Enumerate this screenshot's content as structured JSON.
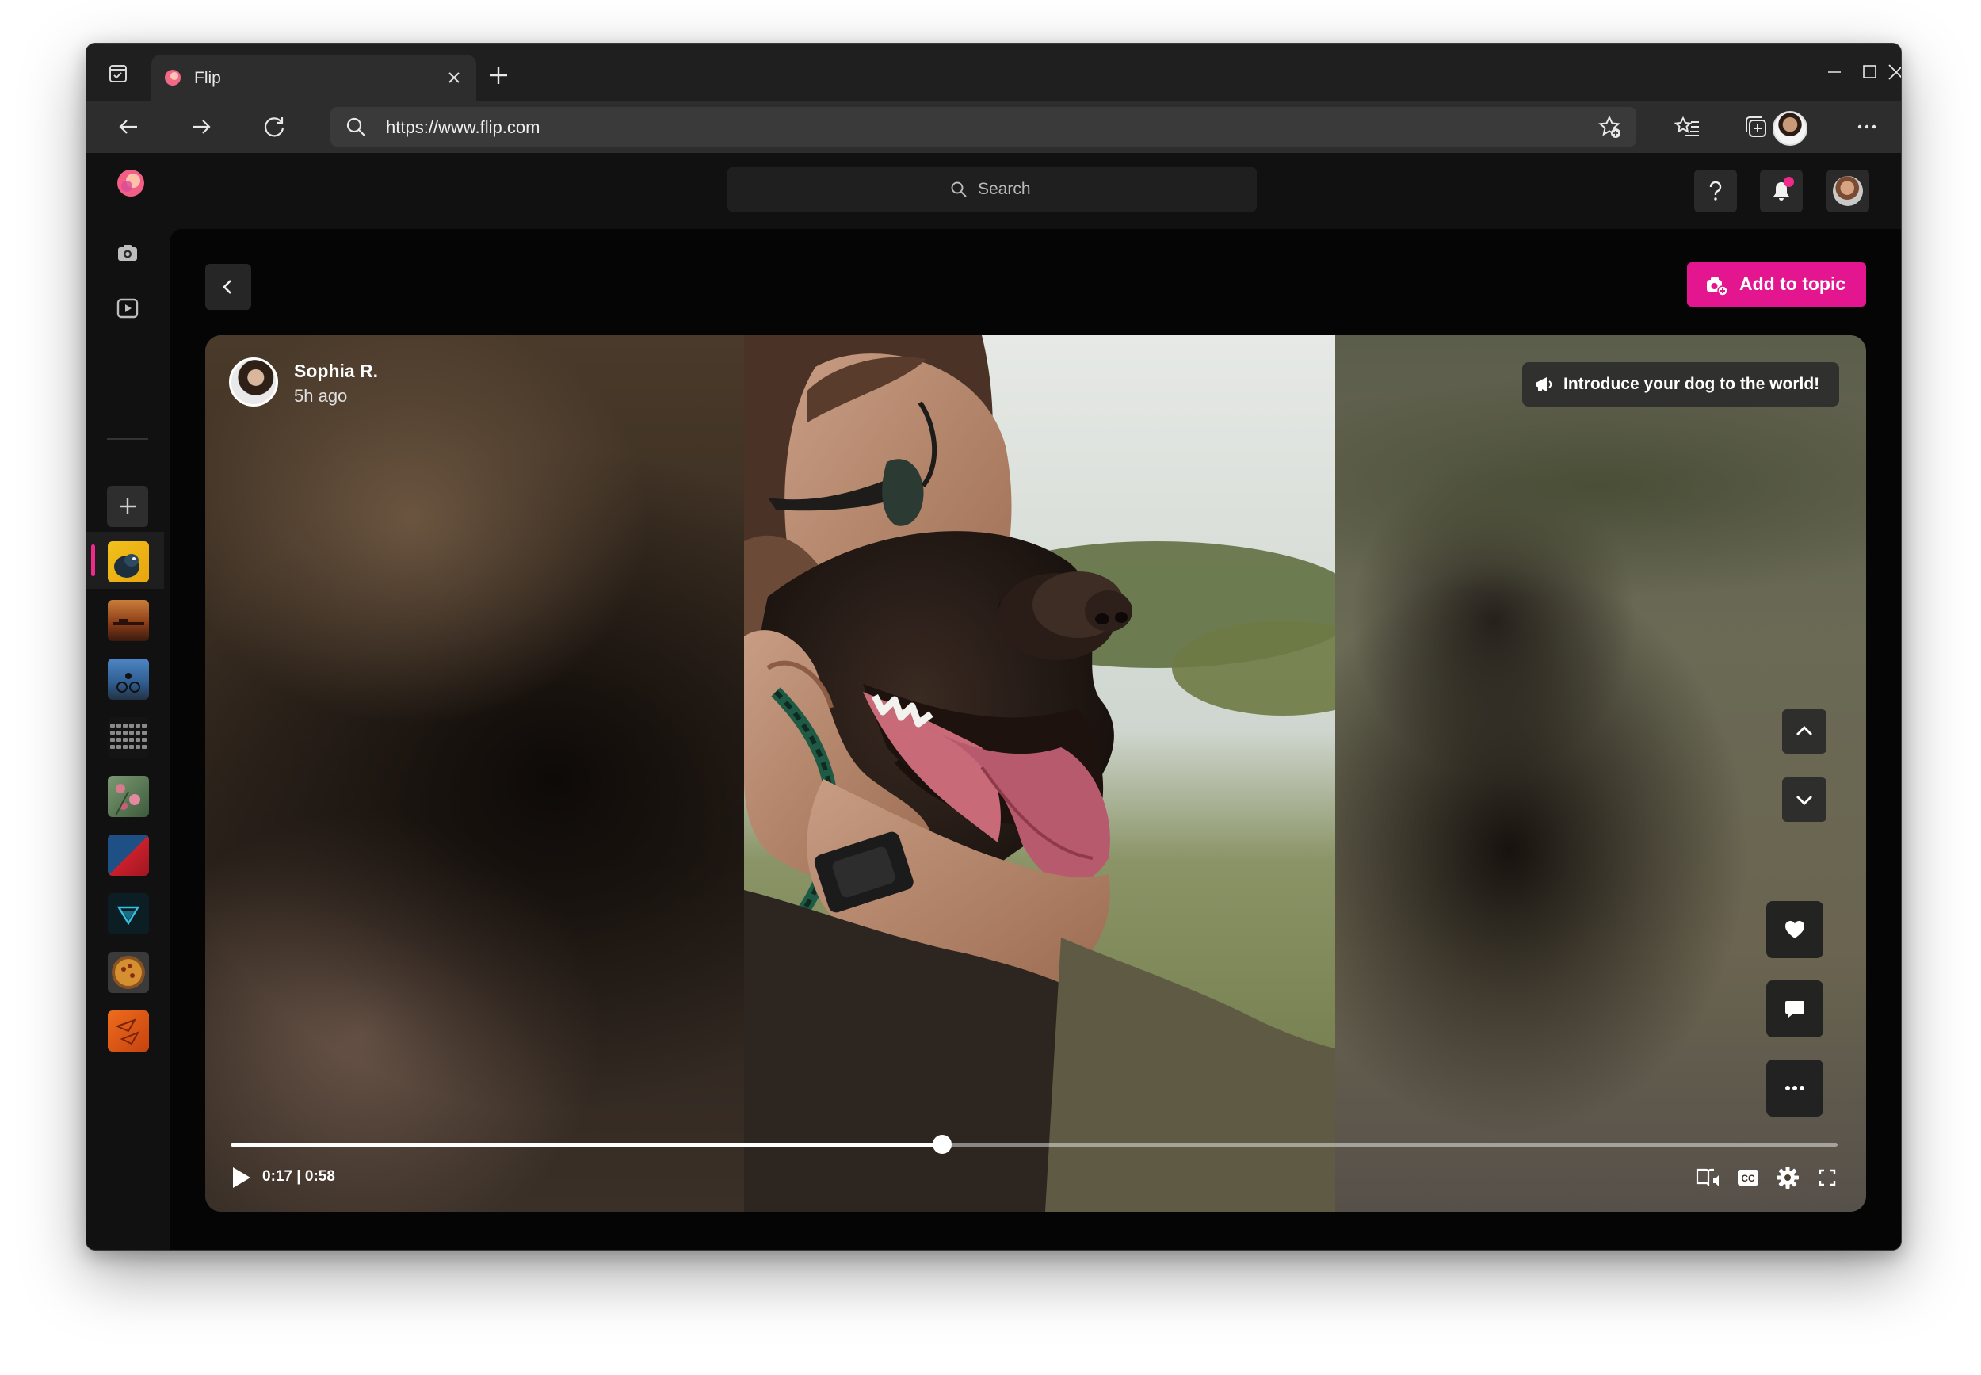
{
  "browser": {
    "tab_title": "Flip",
    "url": "https://www.flip.com"
  },
  "app": {
    "search_placeholder": "Search",
    "add_to_topic_label": "Add to topic",
    "accent": "#e3168f"
  },
  "post": {
    "author_name": "Sophia R.",
    "posted_ago": "5h ago",
    "prompt": "Introduce your dog to the world!",
    "time_current": "0:17",
    "time_total": "0:58",
    "time_display": "0:17 | 0:58",
    "progress": 0.443
  },
  "sidebar": {
    "topics": [
      {
        "name": "dog-topic",
        "colors": [
          "#e8b21a",
          "#1a3c4e"
        ]
      },
      {
        "name": "sunset-topic",
        "colors": [
          "#b0561e",
          "#3c1f12"
        ]
      },
      {
        "name": "cycling-topic",
        "colors": [
          "#3d6fa8",
          "#1f2b3a"
        ]
      },
      {
        "name": "keyboard-topic",
        "colors": [
          "#777777",
          "#222222"
        ]
      },
      {
        "name": "flowers-topic",
        "colors": [
          "#5f8a5a",
          "#c96a7e"
        ]
      },
      {
        "name": "geometry-topic",
        "colors": [
          "#1f4f86",
          "#c42230"
        ]
      },
      {
        "name": "gem-topic",
        "colors": [
          "#0f3542",
          "#35c0e0"
        ]
      },
      {
        "name": "pizza-topic",
        "colors": [
          "#d28a2a",
          "#5a3612"
        ]
      },
      {
        "name": "paper-planes-topic",
        "colors": [
          "#e2641a",
          "#b83c10"
        ]
      }
    ]
  }
}
